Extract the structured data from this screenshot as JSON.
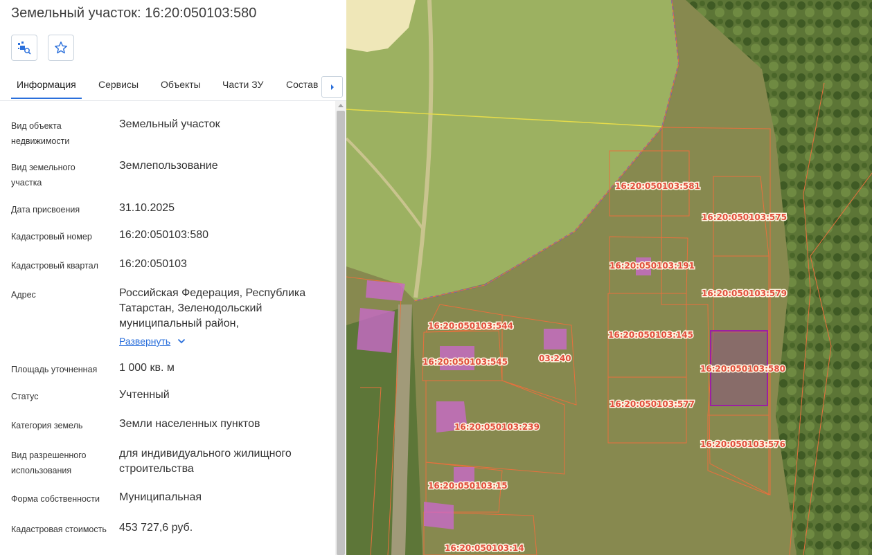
{
  "header": {
    "title": "Земельный участок: 16:20:050103:580"
  },
  "toolbar": {
    "locate_icon": "map-search-icon",
    "favorite_icon": "star-icon"
  },
  "tabs": [
    {
      "label": "Информация",
      "active": true
    },
    {
      "label": "Сервисы",
      "active": false
    },
    {
      "label": "Объекты",
      "active": false
    },
    {
      "label": "Части ЗУ",
      "active": false
    },
    {
      "label": "Состав",
      "active": false
    }
  ],
  "info": {
    "object_type": {
      "label": "Вид объекта недвижимости",
      "value": "Земельный участок"
    },
    "land_type": {
      "label": "Вид земельного участка",
      "value": "Землепользование"
    },
    "assign_date": {
      "label": "Дата присвоения",
      "value": "31.10.2025"
    },
    "cadastral_number": {
      "label": "Кадастровый номер",
      "value": "16:20:050103:580"
    },
    "cadastral_quarter": {
      "label": "Кадастровый квартал",
      "value": "16:20:050103"
    },
    "address": {
      "label": "Адрес",
      "value": "Российская Федерация, Республика Татарстан, Зеленодольский муниципальный район,",
      "expand_label": "Развернуть"
    },
    "area": {
      "label": "Площадь уточненная",
      "value": "1 000 кв. м"
    },
    "status": {
      "label": "Статус",
      "value": "Учтенный"
    },
    "category": {
      "label": "Категория земель",
      "value": "Земли населенных пунктов"
    },
    "permitted_use": {
      "label": "Вид разрешенного использования",
      "value": "для индивидуального жилищного строительства"
    },
    "ownership": {
      "label": "Форма собственности",
      "value": "Муниципальная"
    },
    "cost": {
      "label": "Кадастровая стоимость",
      "value": "453 727,6 руб."
    }
  },
  "map": {
    "parcel_labels": [
      "16:20:050103:581",
      "16:20:050103:575",
      "16:20:050103:191",
      "16:20:050103:579",
      "16:20:050103:544",
      "16:20:050103:145",
      "16:20:050103:545",
      "03:240",
      "16:20:050103:580",
      "16:20:050103:577",
      "16:20:050103:239",
      "16:20:050103:576",
      "16:20:050103:15",
      "16:20:050103:14"
    ],
    "colors": {
      "parcel_border": "#e8703d",
      "selected_border": "#9b1fa3",
      "building": "#c86ac8"
    }
  }
}
